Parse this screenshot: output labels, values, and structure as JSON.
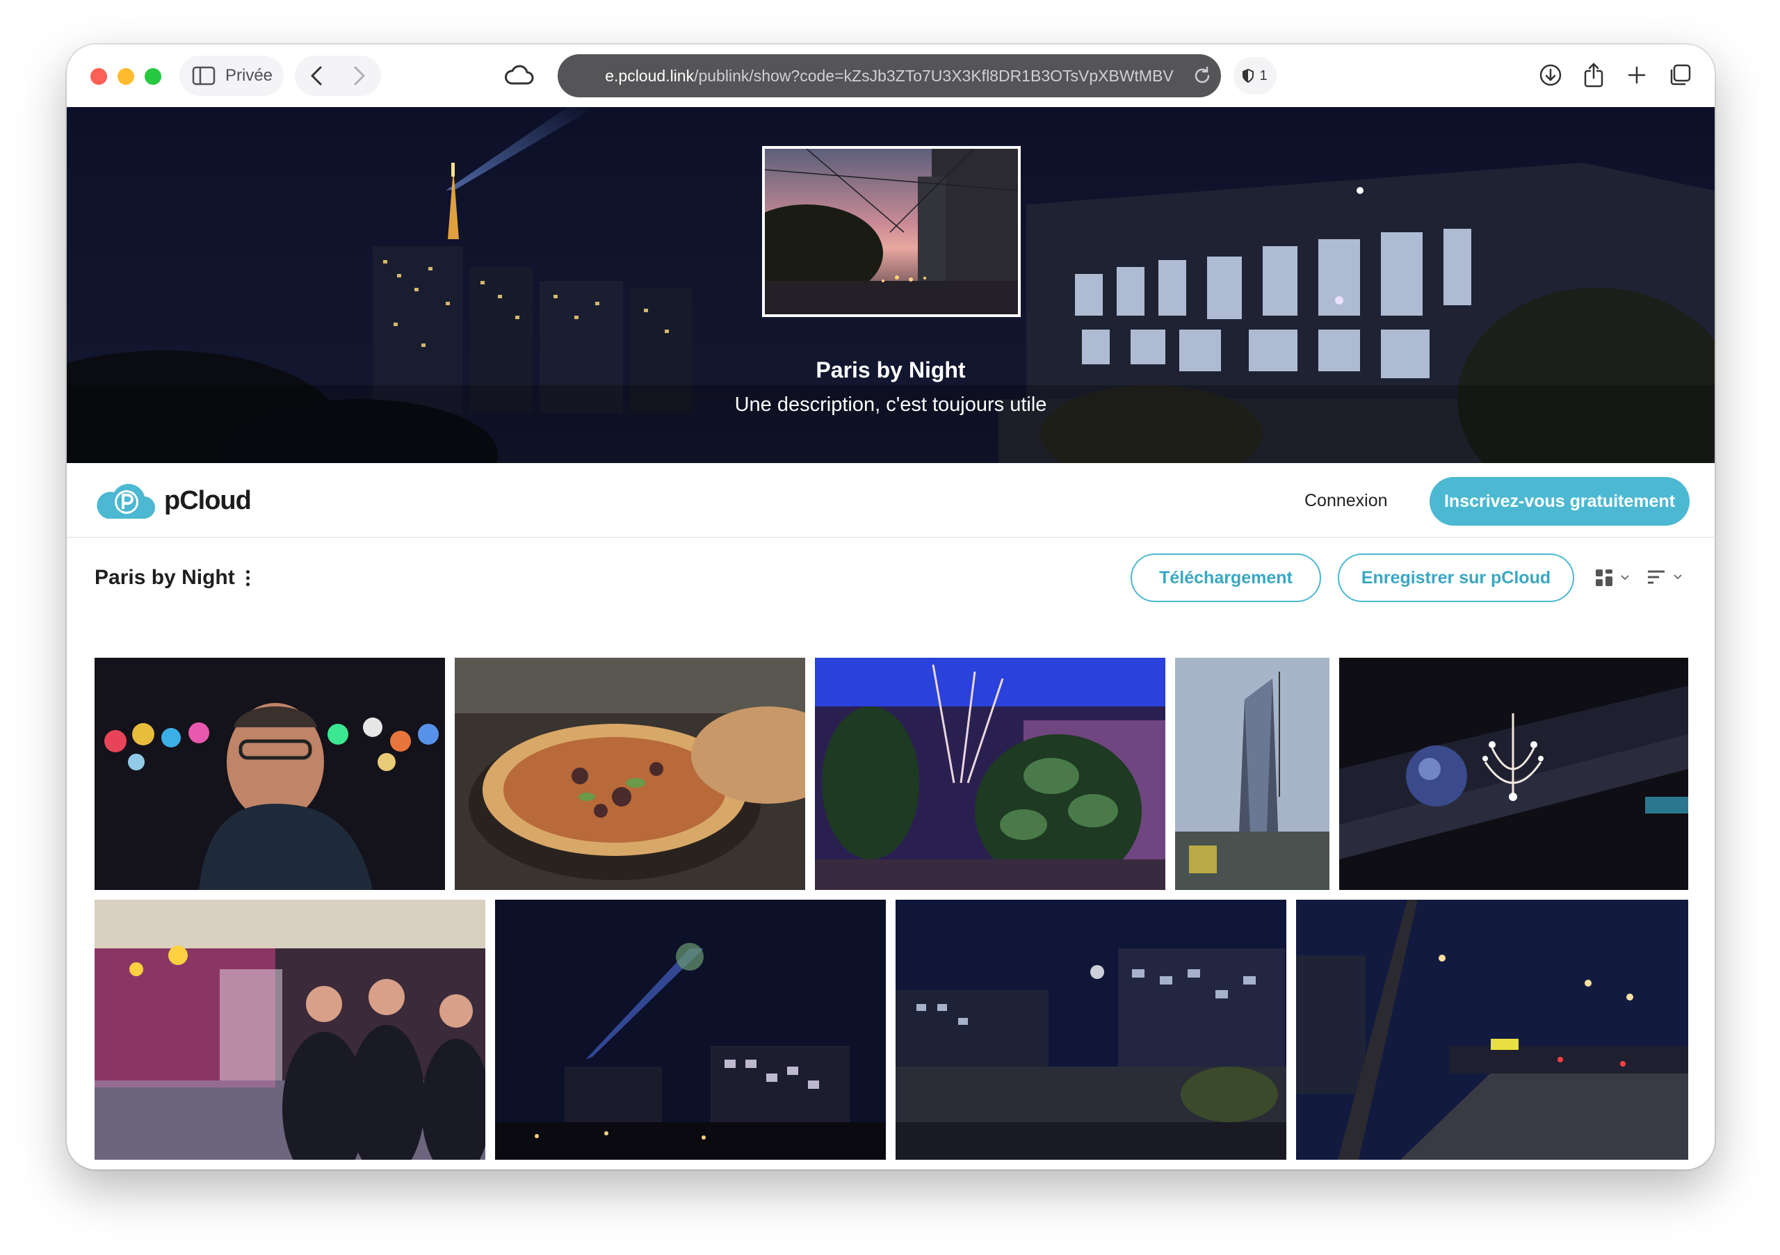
{
  "browser": {
    "private_label": "Privée",
    "url_host": "e.pcloud.link",
    "url_path": "/publink/show?code=kZsJb3ZTo7U3X3Kfl8DR1B3OTsVpXBWtMBV",
    "shield_count": "1"
  },
  "hero": {
    "title": "Paris by Night",
    "description": "Une description, c'est toujours utile"
  },
  "header": {
    "logo_text": "pCloud",
    "login_label": "Connexion",
    "signup_label": "Inscrivez-vous gratuitement"
  },
  "folder": {
    "title": "Paris by Night",
    "download_label": "Téléchargement",
    "save_label": "Enregistrer sur pCloud"
  },
  "colors": {
    "accent": "#4cb8d1",
    "address_bar": "#555558"
  },
  "icons": [
    "sidebar-icon",
    "back-icon",
    "forward-icon",
    "cloud-icon",
    "reload-icon",
    "shield-icon",
    "download-icon",
    "share-icon",
    "new-tab-icon",
    "tabs-icon",
    "grid-view-icon",
    "sort-icon",
    "kebab-menu-icon"
  ]
}
